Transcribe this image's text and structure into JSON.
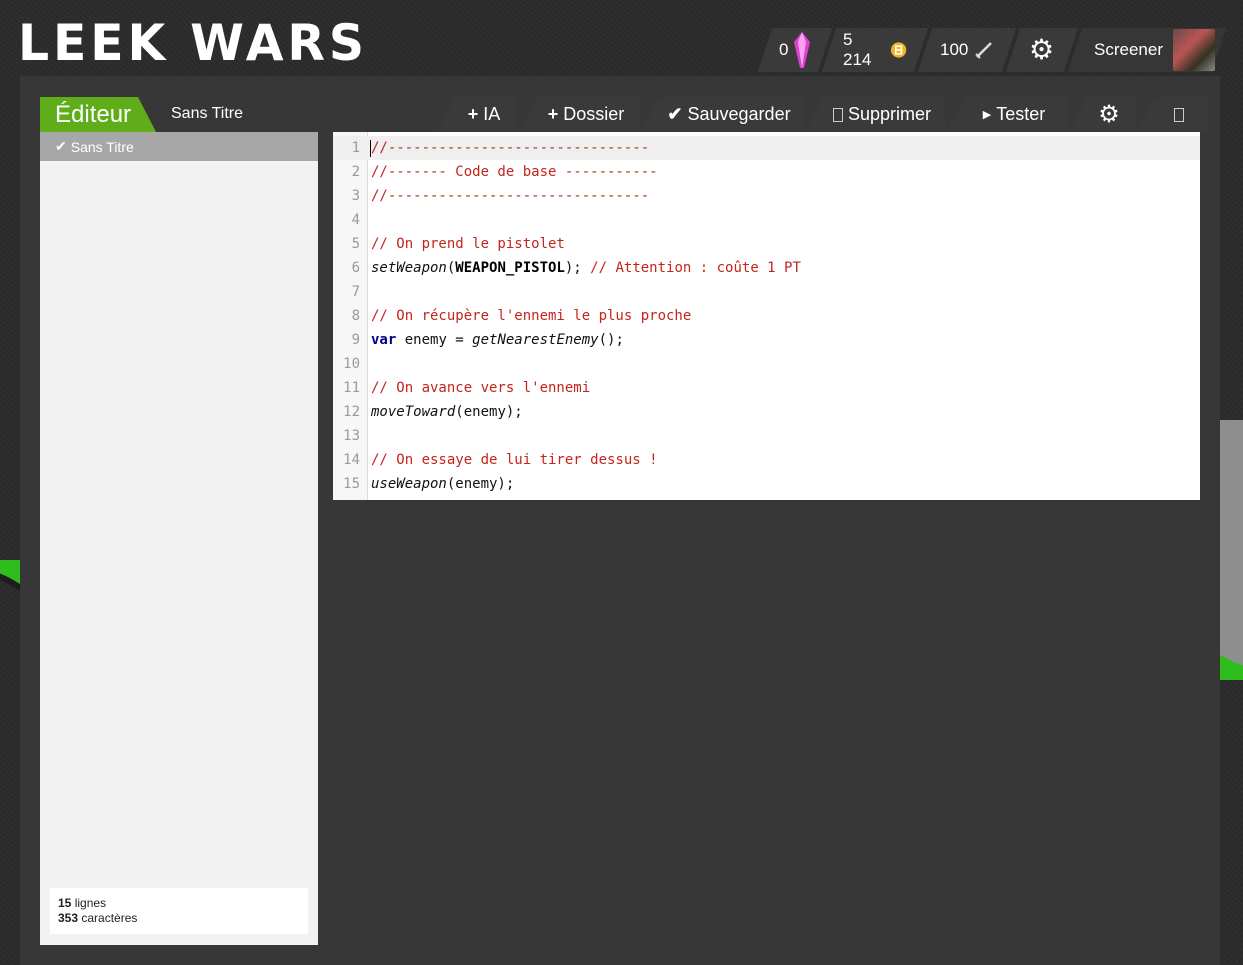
{
  "header": {
    "logo_text": "LEEK WARS",
    "crystals": "0",
    "habs": "5 214",
    "fights": "100",
    "username": "Screener"
  },
  "page": {
    "title": "Éditeur",
    "subtitle": "Sans Titre"
  },
  "sidebar": {
    "active_item": "Sans Titre",
    "stats": {
      "lines_count": "15",
      "lines_label": " lignes",
      "chars_count": "353",
      "chars_label": " caractères"
    }
  },
  "toolbar": {
    "new_ai": "IA",
    "new_folder": "Dossier",
    "save": "Sauvegarder",
    "delete": "Supprimer",
    "test": "Tester"
  },
  "editor": {
    "lines": [
      {
        "n": "1",
        "t": "//-------------------------------"
      },
      {
        "n": "2",
        "t": "//------- Code de base -----------"
      },
      {
        "n": "3",
        "t": "//-------------------------------"
      },
      {
        "n": "4",
        "t": ""
      },
      {
        "n": "5",
        "t": "// On prend le pistolet"
      },
      {
        "n": "6",
        "a": "setWeapon",
        "b": "(",
        "c": "WEAPON_PISTOL",
        "d": "); ",
        "e": "// Attention : coûte 1 PT"
      },
      {
        "n": "7",
        "t": ""
      },
      {
        "n": "8",
        "t": "// On récupère l'ennemi le plus proche"
      },
      {
        "n": "9",
        "a": "var",
        "b": " enemy = ",
        "c": "getNearestEnemy",
        "d": "();"
      },
      {
        "n": "10",
        "t": ""
      },
      {
        "n": "11",
        "t": "// On avance vers l'ennemi"
      },
      {
        "n": "12",
        "a": "moveToward",
        "b": "(enemy);"
      },
      {
        "n": "13",
        "t": ""
      },
      {
        "n": "14",
        "t": "// On essaye de lui tirer dessus !"
      },
      {
        "n": "15",
        "a": "useWeapon",
        "b": "(enemy);"
      }
    ]
  },
  "colors": {
    "accent": "#5fad1b",
    "comment": "#c4241b",
    "keyword": "#00008b"
  }
}
